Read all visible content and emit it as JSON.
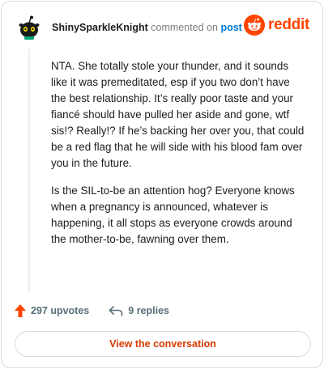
{
  "comment": {
    "username": "ShinySparkleKnight",
    "action_text": "commented on",
    "post_link": "post",
    "paragraphs": [
      "NTA. She totally stole your thunder, and it sounds like it was premeditated, esp if you two don’t have the best relationship. It’s really poor taste and your fiancé should have pulled her aside and gone, wtf sis!? Really!? If he’s backing her over you, that could be a red flag that he will side with his blood fam over you in the future.",
      "Is the SIL-to-be an attention hog? Everyone knows when a pregnancy is announced, whatever is happening, it all stops as everyone crowds around the mother-to-be, fawning over them."
    ],
    "upvotes": "297 upvotes",
    "replies": "9 replies"
  },
  "brand": {
    "name": "reddit",
    "color": "#ff4500"
  },
  "footer": {
    "button_label": "View the conversation"
  },
  "icons": {
    "upvote": "upvote-arrow-icon",
    "reply": "reply-arrow-icon",
    "avatar": "snoo-avatar-icon",
    "logo": "reddit-logo-icon"
  }
}
